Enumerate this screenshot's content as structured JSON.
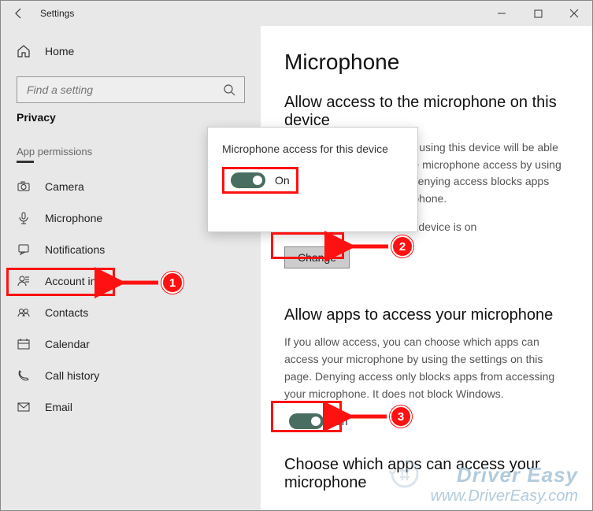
{
  "window": {
    "title": "Settings"
  },
  "sidebar": {
    "home": "Home",
    "search_placeholder": "Find a setting",
    "category": "Privacy",
    "section": "App permissions",
    "items": [
      {
        "icon": "camera-icon",
        "label": "Camera"
      },
      {
        "icon": "microphone-icon",
        "label": "Microphone"
      },
      {
        "icon": "notifications-icon",
        "label": "Notifications"
      },
      {
        "icon": "account-info-icon",
        "label": "Account info"
      },
      {
        "icon": "contacts-icon",
        "label": "Contacts"
      },
      {
        "icon": "calendar-icon",
        "label": "Calendar"
      },
      {
        "icon": "call-history-icon",
        "label": "Call history"
      },
      {
        "icon": "email-icon",
        "label": "Email"
      }
    ]
  },
  "content": {
    "page_title": "Microphone",
    "section1_title": "Allow access to the microphone on this device",
    "section1_body": "If you allow access, people using this device will be able to choose if their apps have microphone access by using the settings on this page. Denying access blocks apps from accessing your microphone.",
    "status_line": "Microphone access for this device is on",
    "change_label": "Change",
    "section2_title": "Allow apps to access your microphone",
    "section2_body": "If you allow access, you can choose which apps can access your microphone by using the settings on this page. Denying access only blocks apps from accessing your microphone. It does not block Windows.",
    "toggle2_state": "On",
    "section3_title": "Choose which apps can access your microphone"
  },
  "popup": {
    "label": "Microphone access for this device",
    "toggle_state": "On"
  },
  "annotations": {
    "n1": "1",
    "n2": "2",
    "n3": "3"
  },
  "watermark": {
    "line1": "Driver Easy",
    "line2": "www.DriverEasy.com"
  },
  "accent_color": "#496d60",
  "highlight_color": "#f11"
}
